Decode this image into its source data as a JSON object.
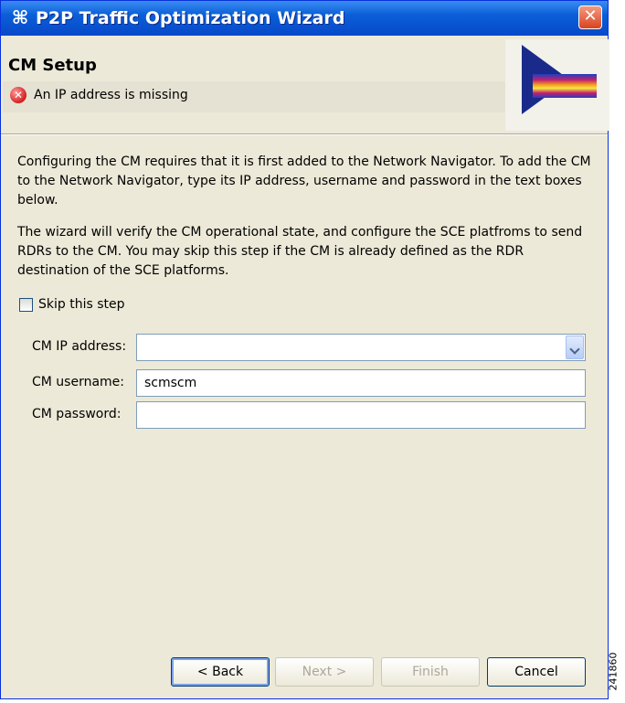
{
  "window": {
    "title": "P2P Traffic Optimization Wizard",
    "close_glyph": "✕",
    "app_icon_glyph": "⌘"
  },
  "banner": {
    "title": "CM Setup",
    "error_icon": "error-icon",
    "error_message": "An IP address is missing"
  },
  "body": {
    "paragraph1": "Configuring the CM requires that it is first added to the Network Navigator. To add the CM to the Network Navigator, type its IP address, username and password in the text boxes below.",
    "paragraph2": "The wizard will verify the CM operational state, and configure the SCE platfroms to send RDRs to the CM. You may skip this step if the CM is already defined as the RDR destination of the SCE platforms.",
    "skip_label": "Skip this step",
    "skip_checked": false
  },
  "form": {
    "ip_label": "CM IP address:",
    "ip_value": "",
    "username_label": "CM username:",
    "username_value": "scmscm",
    "password_label": "CM password:",
    "password_value": ""
  },
  "buttons": {
    "back": "< Back",
    "next": "Next >",
    "finish": "Finish",
    "cancel": "Cancel"
  },
  "watermark": "241860",
  "colors": {
    "title_bar": "#0a5fd8",
    "close": "#d9431f",
    "dialog_bg": "#ece9d8",
    "error": "#d41f1f"
  }
}
